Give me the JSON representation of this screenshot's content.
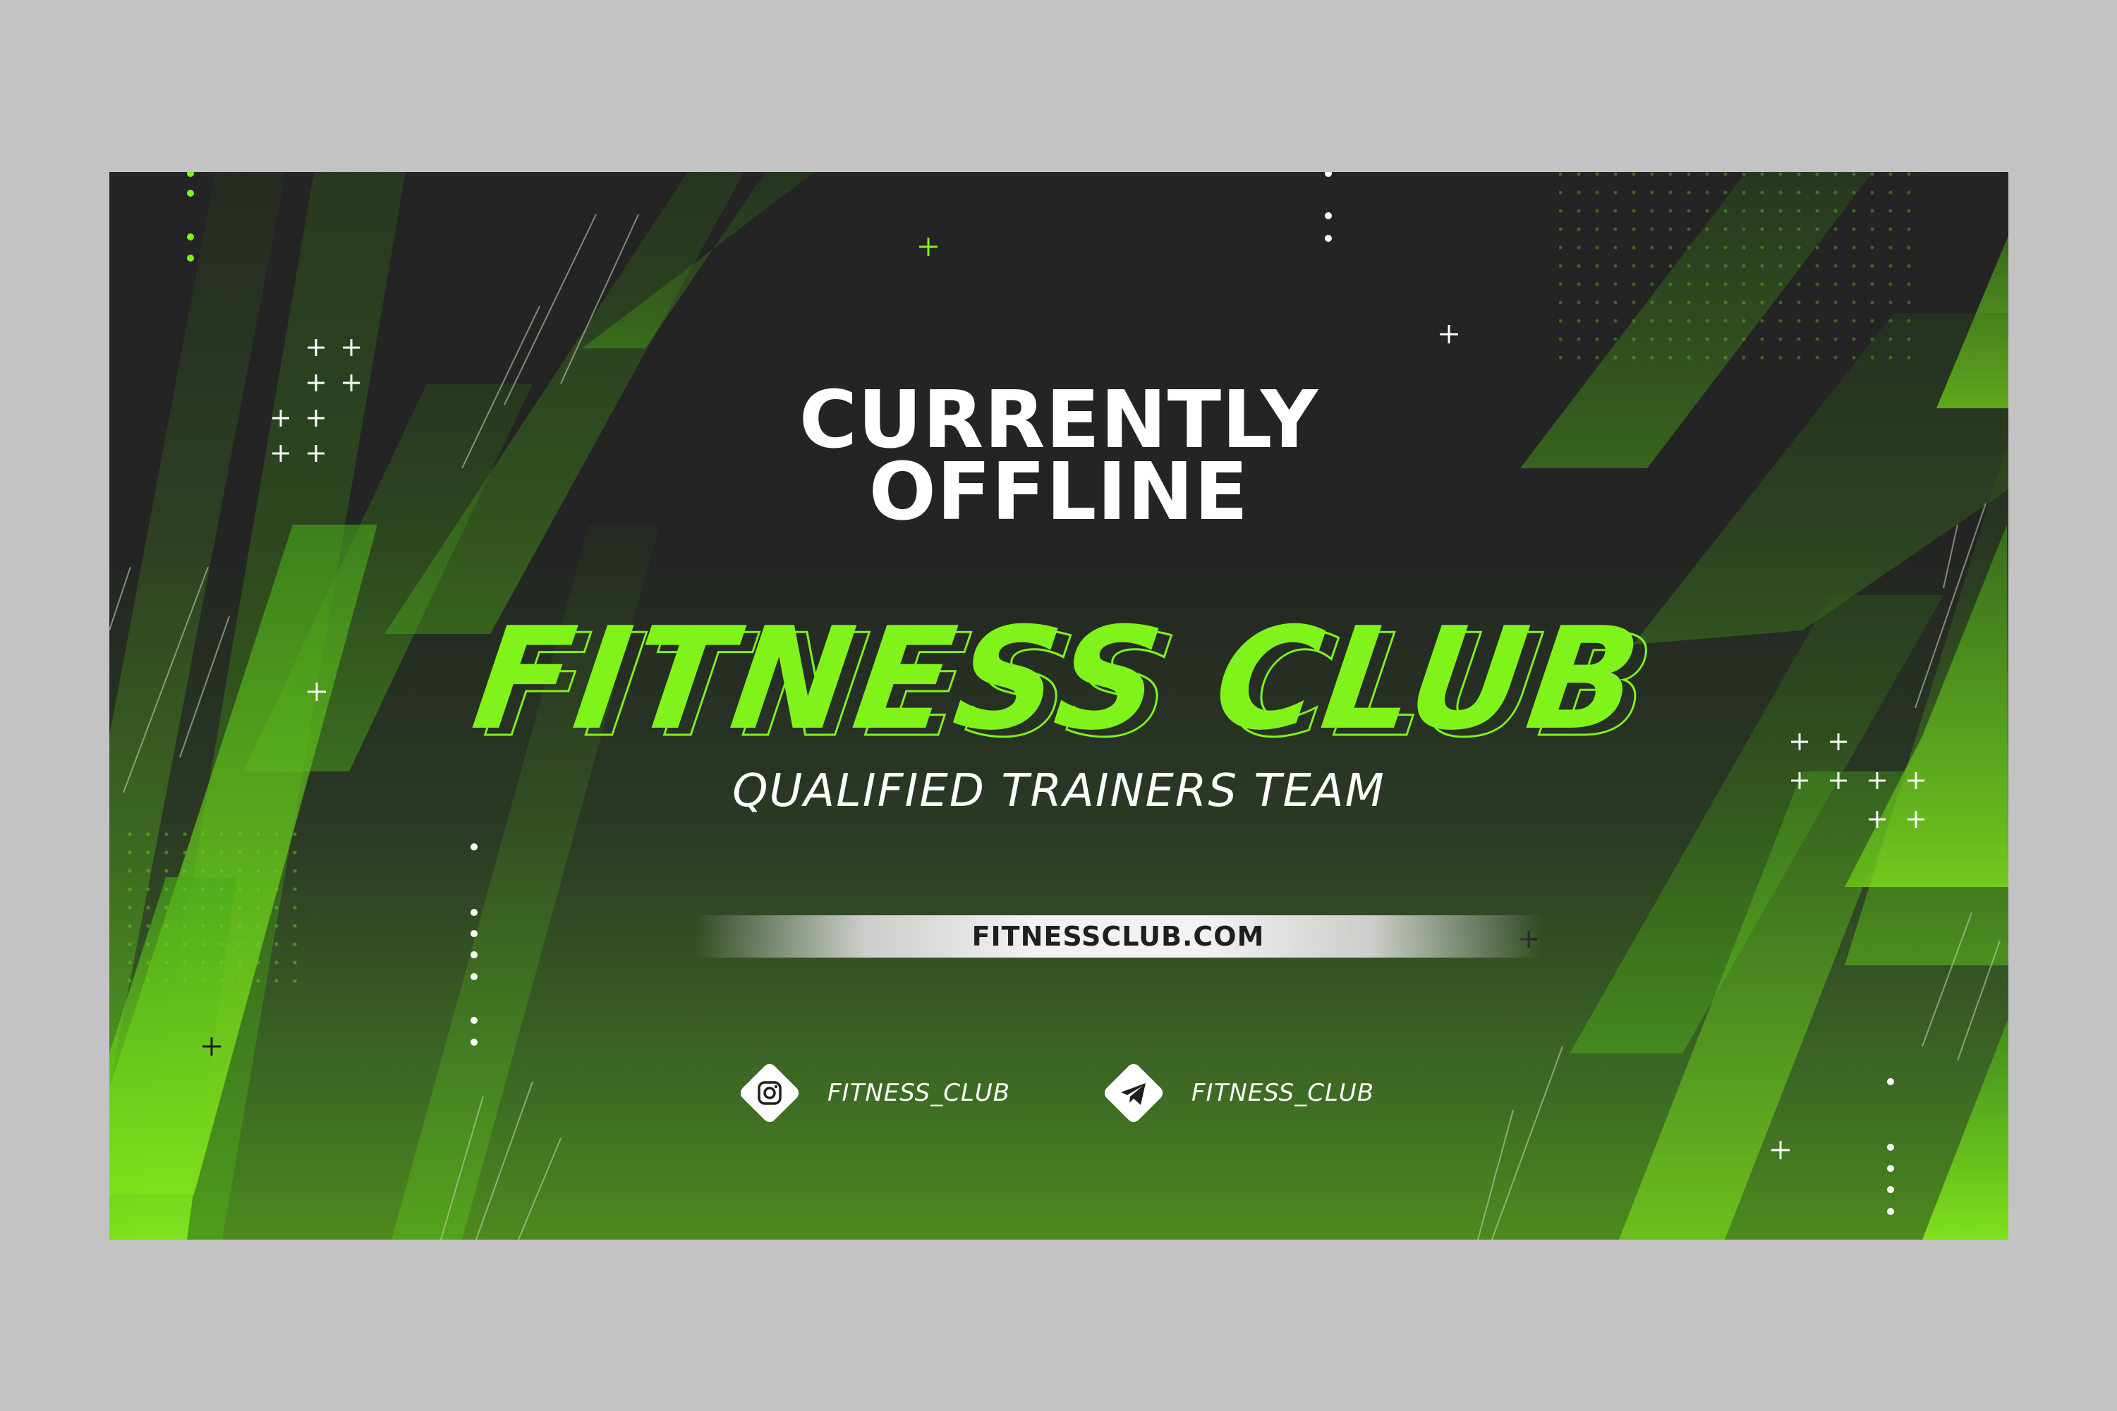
{
  "banner": {
    "headline_line1": "CURRENTLY",
    "headline_line2": "OFFLINE",
    "brand": "FITNESS CLUB",
    "tagline": "QUALIFIED TRAINERS TEAM",
    "website": "FITNESSCLUB.COM"
  },
  "social": [
    {
      "icon": "instagram-icon",
      "handle": "FITNESS_CLUB"
    },
    {
      "icon": "telegram-icon",
      "handle": "FITNESS_CLUB"
    }
  ],
  "colors": {
    "accent": "#7ff31a",
    "background_dark": "#232423",
    "background_green": "#4d8a1e",
    "page_background": "#c3c3c3",
    "text": "#ffffff"
  }
}
